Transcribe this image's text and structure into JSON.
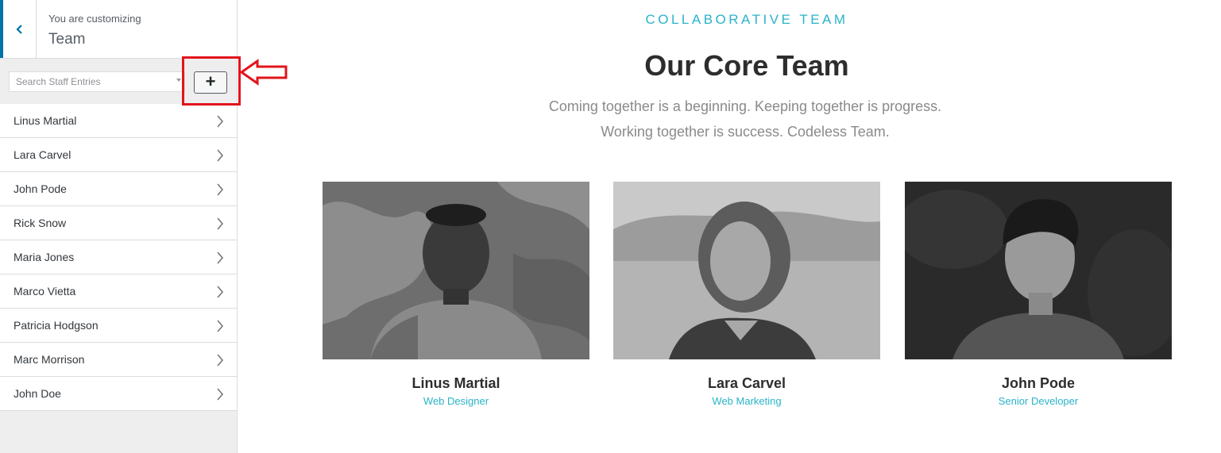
{
  "customizer": {
    "label": "You are customizing",
    "title": "Team"
  },
  "search": {
    "placeholder": "Search Staff Entries"
  },
  "add_button": {
    "label": "+"
  },
  "staff_entries": [
    "Linus Martial",
    "Lara Carvel",
    "John Pode",
    "Rick Snow",
    "Maria Jones",
    "Marco Vietta",
    "Patricia Hodgson",
    "Marc Morrison",
    "John Doe"
  ],
  "section": {
    "eyebrow": "COLLABORATIVE TEAM",
    "headline": "Our Core Team",
    "subtitle_line1": "Coming together is a beginning. Keeping together is progress.",
    "subtitle_line2": "Working together is success. Codeless Team."
  },
  "team": [
    {
      "name": "Linus Martial",
      "role": "Web Designer"
    },
    {
      "name": "Lara Carvel",
      "role": "Web Marketing"
    },
    {
      "name": "John Pode",
      "role": "Senior Developer"
    }
  ],
  "colors": {
    "accent": "#2ab3c9",
    "highlight": "#e3141c",
    "customizer_blue": "#0073aa"
  }
}
